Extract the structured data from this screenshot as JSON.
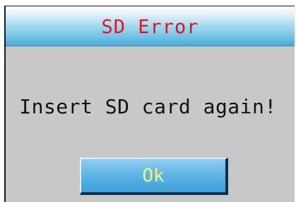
{
  "dialog": {
    "title": "SD Error",
    "message": "Insert SD card again!",
    "ok_label": "Ok"
  },
  "colors": {
    "title_text": "#e0141e",
    "dialog_bg": "#c8c8c8",
    "titlebar_blue": "#4aa9dc",
    "button_blue": "#62b6e6",
    "button_text": "#f6f37a"
  }
}
